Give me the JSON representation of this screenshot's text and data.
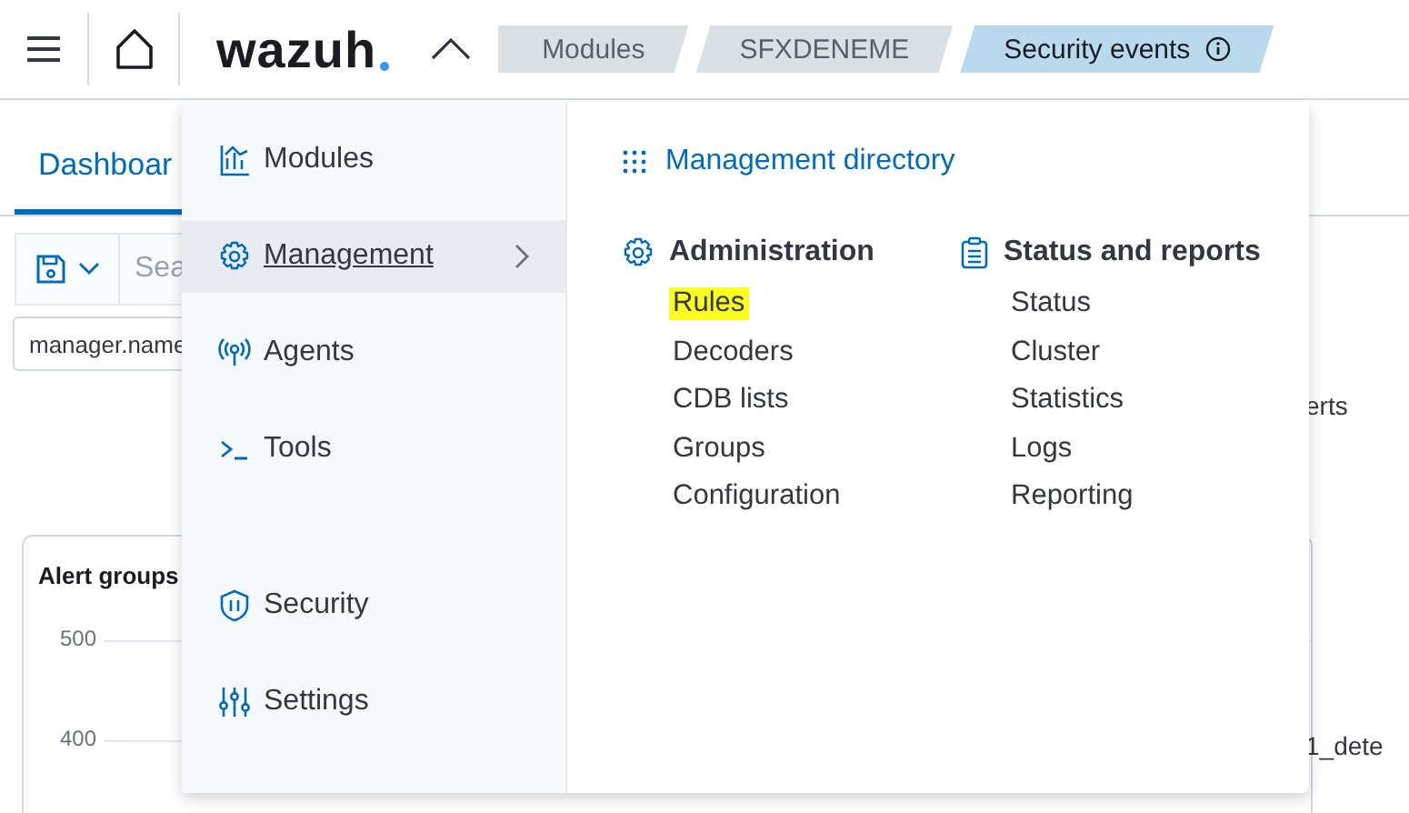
{
  "header": {
    "logo": "wazuh",
    "breadcrumbs": [
      {
        "label": "Modules",
        "selected": false
      },
      {
        "label": "SFXDENEME",
        "selected": false
      },
      {
        "label": "Security events",
        "selected": true
      }
    ]
  },
  "page": {
    "tab": "Dashboar",
    "search_placeholder": "Sea",
    "filter": "manager.name",
    "panel_title": "Alert groups",
    "y_ticks": [
      "500",
      "400"
    ],
    "right_texts": [
      "erts",
      "1_dete"
    ]
  },
  "menu": {
    "items": [
      {
        "label": "Modules",
        "selected": false
      },
      {
        "label": "Management",
        "selected": true
      },
      {
        "label": "Agents",
        "selected": false
      },
      {
        "label": "Tools",
        "selected": false
      }
    ],
    "bottom_items": [
      {
        "label": "Security",
        "selected": false
      },
      {
        "label": "Settings",
        "selected": false
      }
    ],
    "directory_link": "Management directory",
    "sections": [
      {
        "title": "Administration",
        "links": [
          {
            "label": "Rules",
            "highlighted": true
          },
          {
            "label": "Decoders",
            "highlighted": false
          },
          {
            "label": "CDB lists",
            "highlighted": false
          },
          {
            "label": "Groups",
            "highlighted": false
          },
          {
            "label": "Configuration",
            "highlighted": false
          }
        ]
      },
      {
        "title": "Status and reports",
        "links": [
          {
            "label": "Status",
            "highlighted": false
          },
          {
            "label": "Cluster",
            "highlighted": false
          },
          {
            "label": "Statistics",
            "highlighted": false
          },
          {
            "label": "Logs",
            "highlighted": false
          },
          {
            "label": "Reporting",
            "highlighted": false
          }
        ]
      }
    ]
  }
}
